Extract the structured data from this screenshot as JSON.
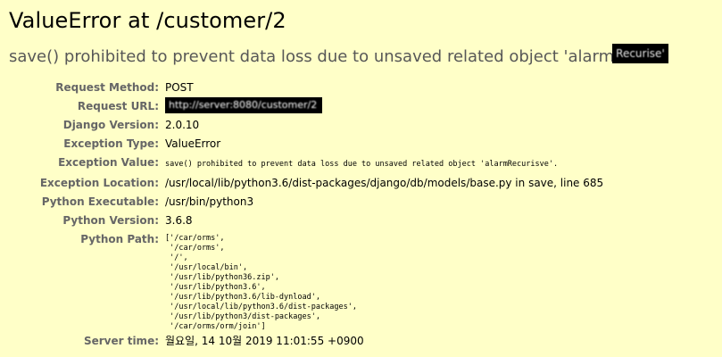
{
  "title": "ValueError at /customer/2",
  "exception_value_prefix": "save() prohibited to prevent data loss due to unsaved related object 'alarm",
  "exception_value_redacted_suffix": "Recurise'",
  "meta": {
    "request_method": {
      "label": "Request Method:",
      "value": "POST"
    },
    "request_url": {
      "label": "Request URL:",
      "value": "http://server:8080/customer/2"
    },
    "django_version": {
      "label": "Django Version:",
      "value": "2.0.10"
    },
    "exception_type": {
      "label": "Exception Type:",
      "value": "ValueError"
    },
    "exception_value": {
      "label": "Exception Value:",
      "value": "save() prohibited to prevent data loss due to unsaved related object 'alarmRecurisve'."
    },
    "exception_location": {
      "label": "Exception Location:",
      "value": "/usr/local/lib/python3.6/dist-packages/django/db/models/base.py in save, line 685"
    },
    "python_executable": {
      "label": "Python Executable:",
      "value": "/usr/bin/python3"
    },
    "python_version": {
      "label": "Python Version:",
      "value": "3.6.8"
    },
    "python_path": {
      "label": "Python Path:",
      "value": "['/car/orms',\n '/car/orms',\n '/',\n '/usr/local/bin',\n '/usr/lib/python36.zip',\n '/usr/lib/python3.6',\n '/usr/lib/python3.6/lib-dynload',\n '/usr/local/lib/python3.6/dist-packages',\n '/usr/lib/python3/dist-packages',\n '/car/orms/orm/join']"
    },
    "server_time": {
      "label": "Server time:",
      "value": "월요일, 14 10월 2019 11:01:55 +0900"
    }
  }
}
